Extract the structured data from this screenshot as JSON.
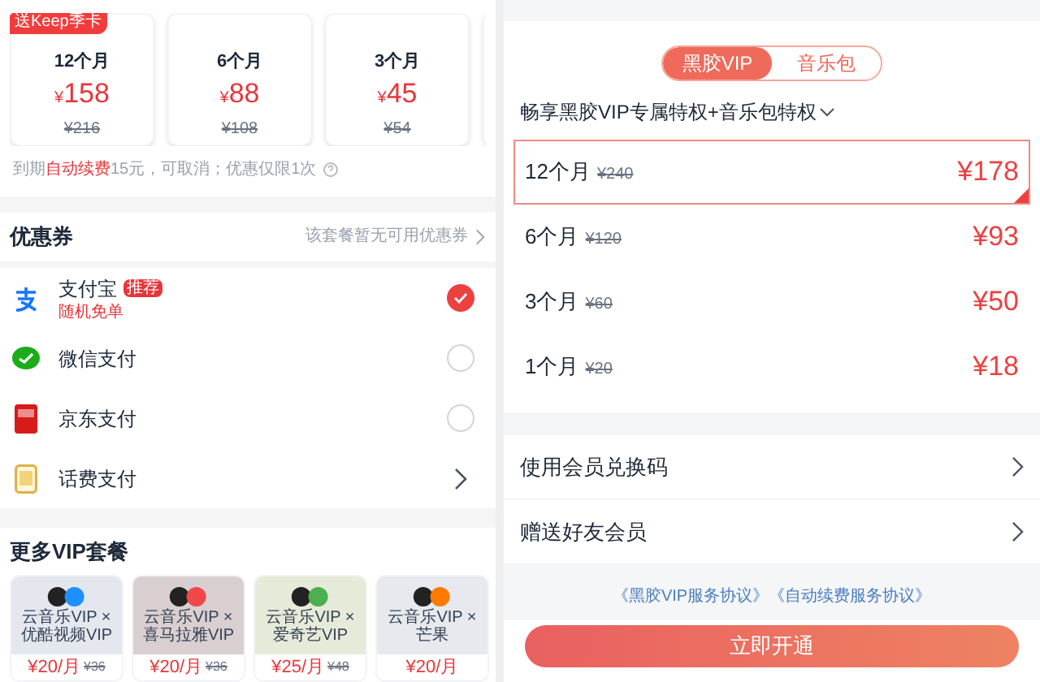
{
  "left": {
    "plans": [
      {
        "badge": "送Keep季卡",
        "term": "12个月",
        "price": "158",
        "original": "¥216"
      },
      {
        "term": "6个月",
        "price": "88",
        "original": "¥108"
      },
      {
        "term": "3个月",
        "price": "45",
        "original": "¥54"
      }
    ],
    "currency": "¥",
    "note": "到期**自动续费**15元，可取消；优惠仅限1次",
    "coupon": {
      "label": "优惠券",
      "value": "该套餐暂无可用优惠券"
    },
    "payments": [
      {
        "kind": "radio",
        "name": "支付宝",
        "badge": "推荐",
        "sub": "随机免单",
        "selected": true
      },
      {
        "kind": "radio",
        "name": "微信支付",
        "selected": false
      },
      {
        "kind": "radio",
        "name": "京东支付",
        "selected": false
      },
      {
        "kind": "link",
        "name": "话费支付"
      }
    ],
    "more_title": "更多VIP套餐",
    "bundles": [
      {
        "name": "云音乐VIP × 优酷视频VIP",
        "price": "¥20/月",
        "original": "¥36",
        "color": "#1e90ff"
      },
      {
        "name": "云音乐VIP × 喜马拉雅VIP",
        "price": "¥20/月",
        "original": "¥36",
        "color": "#f0484a"
      },
      {
        "name": "云音乐VIP × 爱奇艺VIP",
        "price": "¥25/月",
        "original": "¥48",
        "color": "#4caf50"
      },
      {
        "name": "云音乐VIP × 芒果",
        "price": "¥20/月",
        "color": "#ff7a00"
      }
    ]
  },
  "right": {
    "tabs": [
      {
        "label": "黑胶VIP",
        "selected": true
      },
      {
        "label": "音乐包",
        "selected": false
      }
    ],
    "subtitle": "畅享黑胶VIP专属特权+音乐包特权",
    "plans": [
      {
        "term": "12个月",
        "original": "¥240",
        "price": "¥178",
        "selected": true
      },
      {
        "term": "6个月",
        "original": "¥120",
        "price": "¥93",
        "selected": false
      },
      {
        "term": "3个月",
        "original": "¥60",
        "price": "¥50",
        "selected": false
      },
      {
        "term": "1个月",
        "original": "¥20",
        "price": "¥18",
        "selected": false
      }
    ],
    "links": [
      "使用会员兑换码",
      "赠送好友会员"
    ],
    "agreements": [
      "《黑胶VIP服务协议》",
      "《自动续费服务协议》"
    ],
    "cta": "立即开通"
  }
}
